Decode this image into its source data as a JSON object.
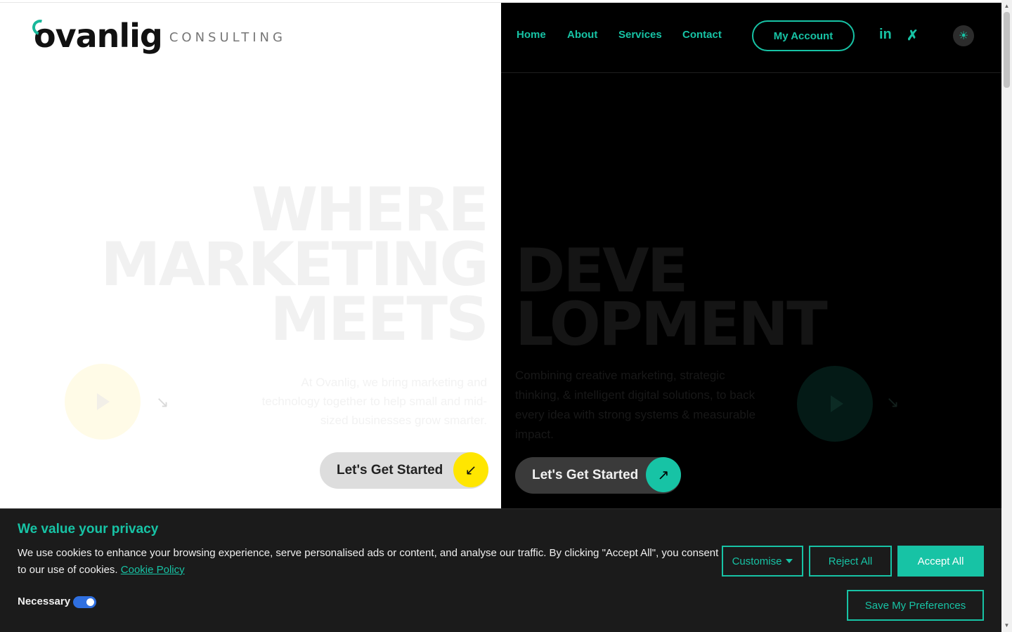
{
  "logo": {
    "name": "ovanlig",
    "tagline": "CONSULTING"
  },
  "nav": {
    "links": [
      "Home",
      "About",
      "Services",
      "Contact"
    ],
    "account_label": "My Account",
    "social": {
      "linkedin": "in",
      "xing": "✗"
    },
    "theme_icon": "sun-icon"
  },
  "hero_left": {
    "lines": [
      "WHERE",
      "MARKETING",
      "MEETS"
    ],
    "description": "At Ovanlig, we bring marketing and technology together to help small and mid-sized businesses grow smarter.",
    "cta_label": "Let's Get Started",
    "cta_icon": "↙",
    "faint_arrow": "↘"
  },
  "hero_right": {
    "lines": [
      "DEVE",
      "LOPMENT"
    ],
    "description": "Combining creative marketing, strategic thinking, & intelligent digital solutions, to back every idea with strong systems & measurable impact.",
    "cta_label": "Let's Get Started",
    "cta_icon": "↗",
    "faint_arrow": "↘"
  },
  "cookie": {
    "title": "We value your privacy",
    "text": "We use cookies to enhance your browsing experience, serve personalised ads or content, and analyse our traffic. By clicking \"Accept All\", you consent to our use of cookies.",
    "link": "Cookie Policy",
    "necessary_label": "Necessary",
    "buttons": {
      "customise": "Customise",
      "reject": "Reject All",
      "accept": "Accept All",
      "save": "Save My Preferences"
    }
  },
  "colors": {
    "accent": "#17c3a5",
    "yellow": "#ffe600",
    "dark": "#000000",
    "banner": "#1b1b1b"
  }
}
